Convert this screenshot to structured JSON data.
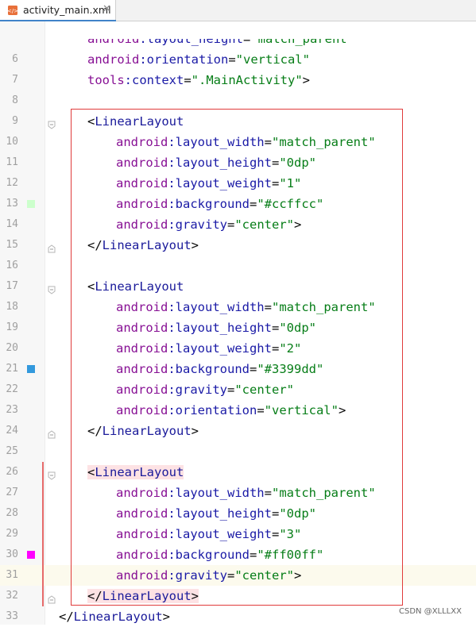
{
  "tab": {
    "filename": "activity_main.xml",
    "close_symbol": "✕",
    "icon": "xml-file-icon"
  },
  "lines": [
    {
      "num": "6",
      "segments": [
        [
          "ns",
          "android"
        ],
        [
          "attr",
          ":orientation"
        ],
        [
          "punc",
          "="
        ],
        [
          "val",
          "\"vertical\""
        ]
      ]
    },
    {
      "num": "7",
      "segments": [
        [
          "ns",
          "tools"
        ],
        [
          "attr",
          ":context"
        ],
        [
          "punc",
          "="
        ],
        [
          "val",
          "\".MainActivity\""
        ],
        [
          "punc",
          ">"
        ]
      ]
    },
    {
      "num": "8",
      "segments": []
    },
    {
      "num": "9",
      "segments": [
        [
          "punc",
          "<"
        ],
        [
          "tag",
          "LinearLayout"
        ]
      ]
    },
    {
      "num": "10",
      "segments": [
        [
          "ns",
          "android"
        ],
        [
          "attr",
          ":layout_width"
        ],
        [
          "punc",
          "="
        ],
        [
          "val",
          "\"match_parent\""
        ]
      ]
    },
    {
      "num": "11",
      "segments": [
        [
          "ns",
          "android"
        ],
        [
          "attr",
          ":layout_height"
        ],
        [
          "punc",
          "="
        ],
        [
          "val",
          "\"0dp\""
        ]
      ]
    },
    {
      "num": "12",
      "segments": [
        [
          "ns",
          "android"
        ],
        [
          "attr",
          ":layout_weight"
        ],
        [
          "punc",
          "="
        ],
        [
          "val",
          "\"1\""
        ]
      ]
    },
    {
      "num": "13",
      "segments": [
        [
          "ns",
          "android"
        ],
        [
          "attr",
          ":background"
        ],
        [
          "punc",
          "="
        ],
        [
          "val",
          "\"#ccffcc\""
        ]
      ]
    },
    {
      "num": "14",
      "segments": [
        [
          "ns",
          "android"
        ],
        [
          "attr",
          ":gravity"
        ],
        [
          "punc",
          "="
        ],
        [
          "val",
          "\"center\""
        ],
        [
          "punc",
          ">"
        ]
      ]
    },
    {
      "num": "15",
      "segments": [
        [
          "punc",
          "</"
        ],
        [
          "tag",
          "LinearLayout"
        ],
        [
          "punc",
          ">"
        ]
      ]
    },
    {
      "num": "16",
      "segments": []
    },
    {
      "num": "17",
      "segments": [
        [
          "punc",
          "<"
        ],
        [
          "tag",
          "LinearLayout"
        ]
      ]
    },
    {
      "num": "18",
      "segments": [
        [
          "ns",
          "android"
        ],
        [
          "attr",
          ":layout_width"
        ],
        [
          "punc",
          "="
        ],
        [
          "val",
          "\"match_parent\""
        ]
      ]
    },
    {
      "num": "19",
      "segments": [
        [
          "ns",
          "android"
        ],
        [
          "attr",
          ":layout_height"
        ],
        [
          "punc",
          "="
        ],
        [
          "val",
          "\"0dp\""
        ]
      ]
    },
    {
      "num": "20",
      "segments": [
        [
          "ns",
          "android"
        ],
        [
          "attr",
          ":layout_weight"
        ],
        [
          "punc",
          "="
        ],
        [
          "val",
          "\"2\""
        ]
      ]
    },
    {
      "num": "21",
      "segments": [
        [
          "ns",
          "android"
        ],
        [
          "attr",
          ":background"
        ],
        [
          "punc",
          "="
        ],
        [
          "val",
          "\"#3399dd\""
        ]
      ]
    },
    {
      "num": "22",
      "segments": [
        [
          "ns",
          "android"
        ],
        [
          "attr",
          ":gravity"
        ],
        [
          "punc",
          "="
        ],
        [
          "val",
          "\"center\""
        ]
      ]
    },
    {
      "num": "23",
      "segments": [
        [
          "ns",
          "android"
        ],
        [
          "attr",
          ":orientation"
        ],
        [
          "punc",
          "="
        ],
        [
          "val",
          "\"vertical\""
        ],
        [
          "punc",
          ">"
        ]
      ]
    },
    {
      "num": "24",
      "segments": [
        [
          "punc",
          "</"
        ],
        [
          "tag",
          "LinearLayout"
        ],
        [
          "punc",
          ">"
        ]
      ]
    },
    {
      "num": "25",
      "segments": []
    },
    {
      "num": "26",
      "segments": [
        [
          "punc",
          "<"
        ],
        [
          "tag",
          "LinearLayout"
        ]
      ]
    },
    {
      "num": "27",
      "segments": [
        [
          "ns",
          "android"
        ],
        [
          "attr",
          ":layout_width"
        ],
        [
          "punc",
          "="
        ],
        [
          "val",
          "\"match_parent\""
        ]
      ]
    },
    {
      "num": "28",
      "segments": [
        [
          "ns",
          "android"
        ],
        [
          "attr",
          ":layout_height"
        ],
        [
          "punc",
          "="
        ],
        [
          "val",
          "\"0dp\""
        ]
      ]
    },
    {
      "num": "29",
      "segments": [
        [
          "ns",
          "android"
        ],
        [
          "attr",
          ":layout_weight"
        ],
        [
          "punc",
          "="
        ],
        [
          "val",
          "\"3\""
        ]
      ]
    },
    {
      "num": "30",
      "segments": [
        [
          "ns",
          "android"
        ],
        [
          "attr",
          ":background"
        ],
        [
          "punc",
          "="
        ],
        [
          "val",
          "\"#ff00ff\""
        ]
      ]
    },
    {
      "num": "31",
      "segments": [
        [
          "ns",
          "android"
        ],
        [
          "attr",
          ":gravity"
        ],
        [
          "punc",
          "="
        ],
        [
          "val",
          "\"center\""
        ],
        [
          "punc",
          ">"
        ]
      ]
    },
    {
      "num": "32",
      "segments": [
        [
          "punc",
          "</"
        ],
        [
          "tag",
          "LinearLayout"
        ],
        [
          "punc",
          ">"
        ]
      ]
    },
    {
      "num": "33",
      "segments": [
        [
          "punc",
          "</"
        ],
        [
          "tag",
          "LinearLayout"
        ],
        [
          "punc",
          ">"
        ]
      ]
    }
  ],
  "partial_top_line": [
    [
      "ns",
      "android"
    ],
    [
      "attr",
      ":layout_height"
    ],
    [
      "punc",
      "="
    ],
    [
      "val",
      "\"match_parent\""
    ]
  ],
  "gutter_colors": {
    "13": "#ccffcc",
    "21": "#3399dd",
    "30": "#ff00ff"
  },
  "watermark": "CSDN @XLLLXX"
}
